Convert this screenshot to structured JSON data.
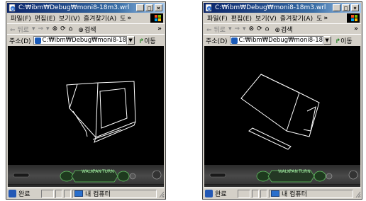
{
  "windows": [
    {
      "title": "C:₩ibm₩Debug₩moni8-18m3.wrl",
      "menu": [
        "파일(F)",
        "편집(E)",
        "보기(V)",
        "즐겨찾기(A)",
        "도"
      ],
      "toolbar": {
        "back": "⇐ 뒤로",
        "forward": "⇒",
        "search": "검색"
      },
      "address": {
        "label": "주소(D)",
        "value": "C:₩ibm₩Debug₩moni8-18m3.",
        "go": "이동"
      },
      "status": {
        "done": "완료",
        "zone": "내 컴퓨터"
      },
      "dashboard": {
        "labels": [
          "WALK",
          "PAN",
          "TURN"
        ]
      }
    },
    {
      "title": "C:₩ibm₩Debug₩moni8-18m3.wrl",
      "menu": [
        "파일(F)",
        "편집(E)",
        "보기(V)",
        "즐겨찾기(A)",
        "도"
      ],
      "toolbar": {
        "back": "⇐ 뒤로",
        "forward": "⇒",
        "search": "검색"
      },
      "address": {
        "label": "주소(D)",
        "value": "C:₩ibm₩Debug₩moni8-18m3.",
        "go": "이동"
      },
      "status": {
        "done": "완료",
        "zone": "내 컴퓨터"
      },
      "dashboard": {
        "labels": [
          "WALK",
          "PAN",
          "TURN"
        ]
      }
    }
  ],
  "icons": {
    "title": "ie-page-icon",
    "minimize": "minimize-icon",
    "maximize": "maximize-icon",
    "close": "close-icon",
    "windows_logo": "windows-logo-icon",
    "stop": "stop-icon",
    "refresh": "refresh-icon",
    "home": "home-icon",
    "search": "search-icon"
  },
  "colors": {
    "titlebar": "#0a246a",
    "viewport": "#000000",
    "wireframe": "#ffffff",
    "dashboard_accent": "#4cc04c"
  }
}
